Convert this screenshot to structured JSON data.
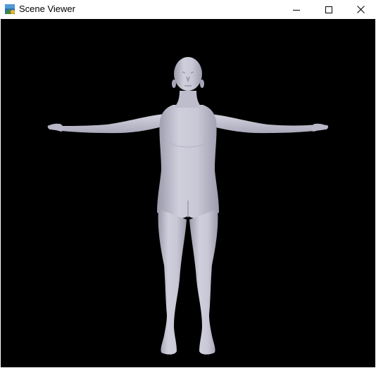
{
  "window": {
    "title": "Scene Viewer",
    "app_icon": "scene-viewer-app-icon",
    "controls": {
      "minimize_icon": "minimize-icon",
      "maximize_icon": "maximize-icon",
      "close_icon": "close-icon"
    }
  },
  "viewport": {
    "background_color": "#000000",
    "model_color": "#c4c4d2",
    "model": "human-body-t-pose"
  }
}
